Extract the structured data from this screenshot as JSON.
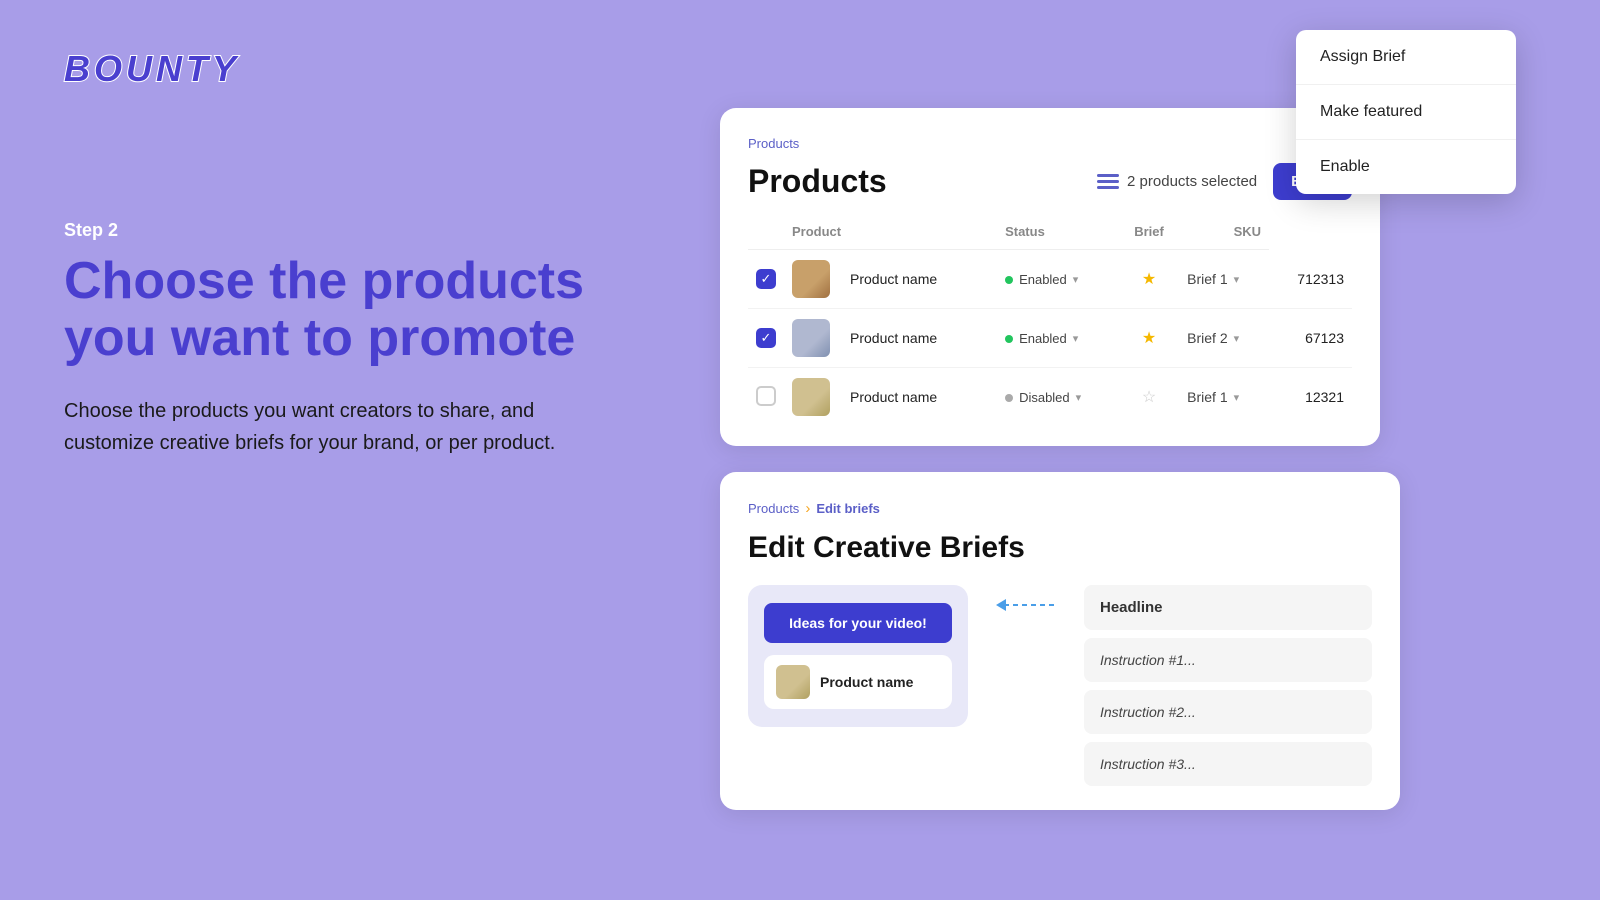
{
  "logo": {
    "text": "BOUNTY"
  },
  "left": {
    "step_label": "Step 2",
    "heading_line1": "Choose the products",
    "heading_line2": "you want to promote",
    "sub_text": "Choose the products you want creators to share, and customize creative briefs for your brand, or per product."
  },
  "dropdown": {
    "items": [
      {
        "id": "assign-brief",
        "label": "Assign Brief"
      },
      {
        "id": "make-featured",
        "label": "Make featured"
      },
      {
        "id": "enable",
        "label": "Enable"
      }
    ]
  },
  "products_card": {
    "breadcrumb": "Products",
    "title": "Products",
    "selected_text": "2 products selected",
    "edit_label": "Edit",
    "table": {
      "headers": [
        "",
        "Product",
        "Status",
        "Brief",
        "SKU"
      ],
      "rows": [
        {
          "checked": true,
          "product_name": "Product name",
          "img_class": "img-1",
          "status": "Enabled",
          "status_active": true,
          "star": true,
          "brief": "Brief 1",
          "sku": "712313"
        },
        {
          "checked": true,
          "product_name": "Product name",
          "img_class": "img-2",
          "status": "Enabled",
          "status_active": true,
          "star": true,
          "brief": "Brief 2",
          "sku": "67123"
        },
        {
          "checked": false,
          "product_name": "Product name",
          "img_class": "img-3",
          "status": "Disabled",
          "status_active": false,
          "star": false,
          "brief": "Brief 1",
          "sku": "12321"
        }
      ]
    }
  },
  "briefs_card": {
    "breadcrumb_products": "Products",
    "breadcrumb_sep": "›",
    "breadcrumb_active": "Edit briefs",
    "title": "Edit Creative Briefs",
    "ideas_btn_label": "Ideas for your video!",
    "product_name": "Product name",
    "fields": {
      "headline": "Headline",
      "instruction1": "Instruction #1...",
      "instruction2": "Instruction #2...",
      "instruction3": "Instruction #3..."
    }
  }
}
